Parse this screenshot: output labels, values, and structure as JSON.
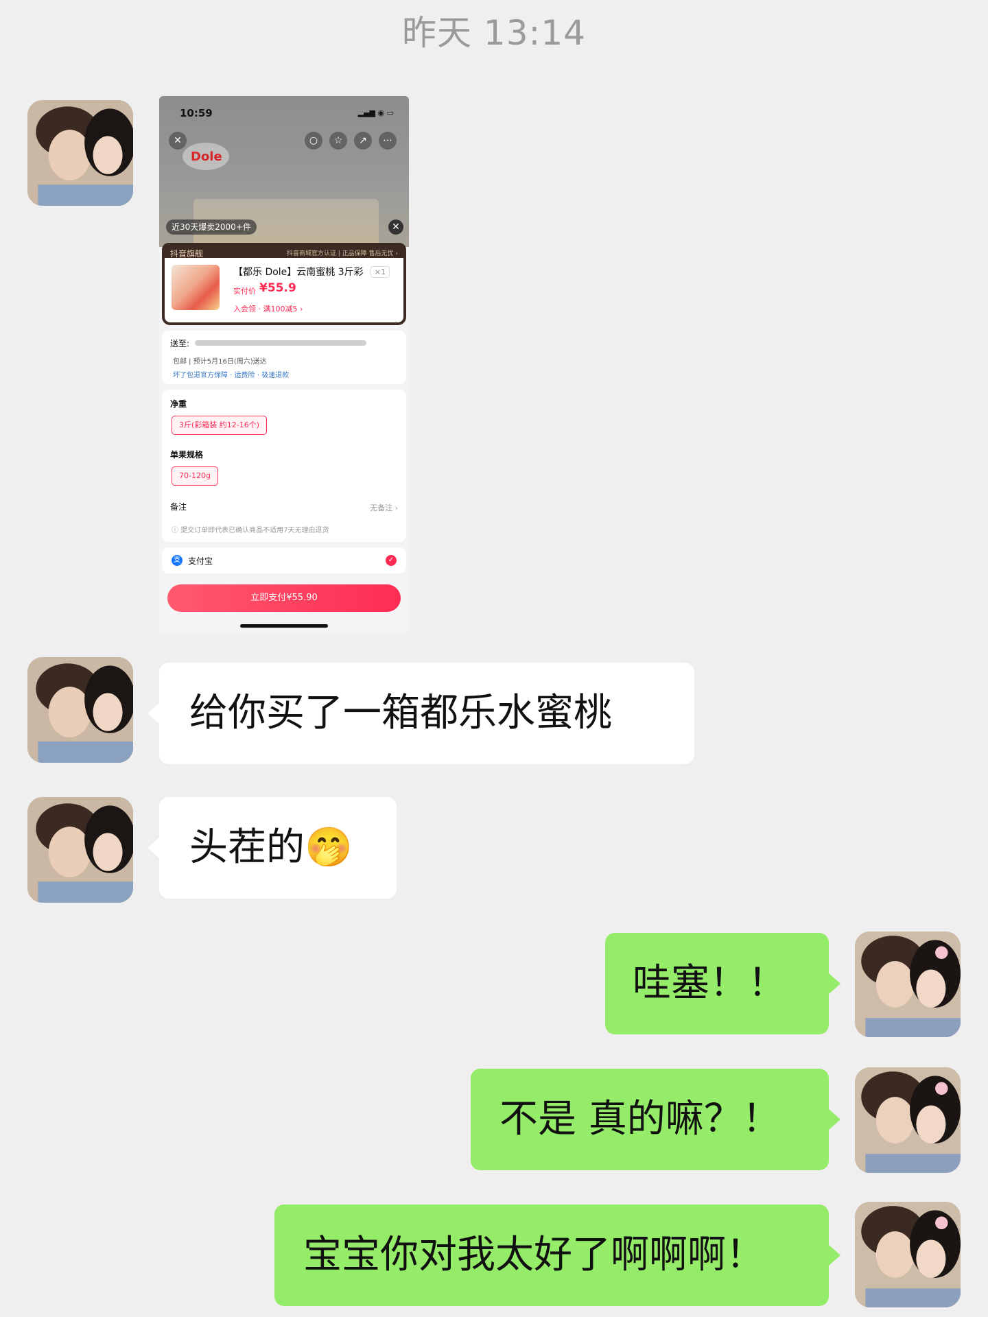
{
  "header": {
    "timestamp": "昨天 13:14"
  },
  "screenshot": {
    "status_time": "10:59",
    "status_icons": "▂▄▆ ◉ ▭",
    "logo_text": "Dole",
    "sold_badge": "近30天爆卖2000+件",
    "store_label": "抖音旗舰",
    "store_tags": "抖音商城官方认证 | 正品保障  售后无忧 ›",
    "product_name": "【都乐 Dole】云南蜜桃 3斤彩",
    "quantity": "×1",
    "price_label": "实付价",
    "price": "¥55.9",
    "promo": "入会领 · 满100减5 ›",
    "deliver_to_label": "送至:",
    "shipping": "包邮 | 预计5月16日(周六)送达",
    "assurance": "坏了包退官方保障 · 运费险 · 极速退款",
    "weight_label": "净重",
    "weight_option": "3斤(彩箱装 约12-16个)",
    "size_label": "单果规格",
    "size_option": "70-120g",
    "remark_label": "备注",
    "remark_value": "无备注 ›",
    "notice": "ⓘ 提交订单即代表已确认商品不适用7天无理由退货",
    "payment_method": "支付宝",
    "pay_button": "立即支付¥55.90"
  },
  "messages": [
    {
      "side": "left",
      "text": "给你买了一箱都乐水蜜桃"
    },
    {
      "side": "left",
      "text": "头茬的🤭"
    },
    {
      "side": "right",
      "text": "哇塞！！"
    },
    {
      "side": "right",
      "text": "不是 真的嘛？！"
    },
    {
      "side": "right",
      "text": "宝宝你对我太好了啊啊啊！"
    }
  ],
  "colors": {
    "background": "#efefef",
    "incoming_bubble": "#ffffff",
    "outgoing_bubble": "#95ec69",
    "douyin_red": "#fe2c55"
  }
}
